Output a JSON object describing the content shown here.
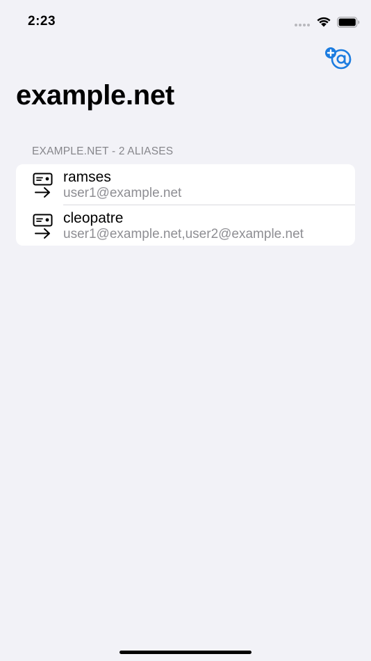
{
  "status_bar": {
    "time": "2:23"
  },
  "nav": {
    "add_button_icon": "add-alias-icon",
    "accent_color": "#1c7ce0"
  },
  "title": "example.net",
  "section": {
    "header": "EXAMPLE.NET - 2 ALIASES",
    "items": [
      {
        "name": "ramses",
        "targets": "user1@example.net",
        "icon": "mail-forward-icon"
      },
      {
        "name": "cleopatre",
        "targets": "user1@example.net,user2@example.net",
        "icon": "mail-forward-icon"
      }
    ]
  }
}
